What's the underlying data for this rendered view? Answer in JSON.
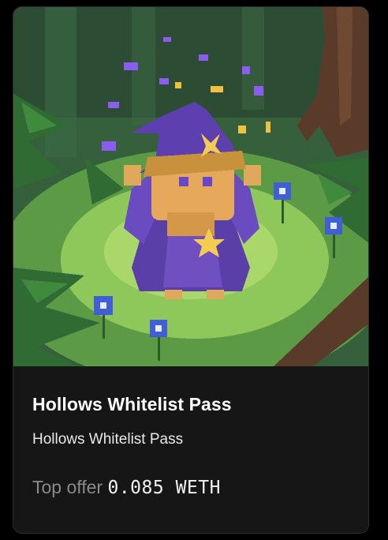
{
  "nft": {
    "image_alt": "Pixel art wizard in purple hat and robe standing in a forest clearing",
    "title": "Hollows Whitelist Pass",
    "collection": "Hollows Whitelist Pass",
    "offer_label": "Top offer",
    "offer_value": "0.085 WETH"
  },
  "colors": {
    "card_bg": "#161616",
    "title": "#ffffff",
    "muted": "#8a8a8a",
    "robe_purple": "#5b3fa8",
    "forest_green": "#3f7d3a"
  }
}
